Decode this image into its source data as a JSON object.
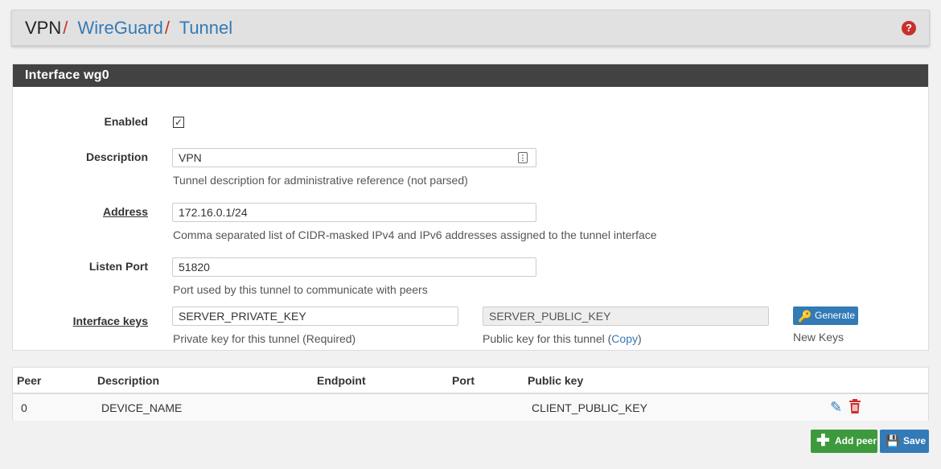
{
  "breadcrumb": {
    "root": "VPN",
    "level1": "WireGuard",
    "level2": "Tunnel",
    "separator": "/"
  },
  "help_icon": "question-circle-icon",
  "panel": {
    "title": "Interface wg0",
    "fields": {
      "enabled": {
        "label": "Enabled",
        "checked": true
      },
      "description": {
        "label": "Description",
        "value": "VPN",
        "hint": "Tunnel description for administrative reference (not parsed)"
      },
      "address": {
        "label": "Address",
        "value": "172.16.0.1/24",
        "hint": "Comma separated list of CIDR-masked IPv4 and IPv6 addresses assigned to the tunnel interface"
      },
      "listen_port": {
        "label": "Listen Port",
        "value": "51820",
        "hint": "Port used by this tunnel to communicate with peers"
      },
      "interface_keys": {
        "label": "Interface keys",
        "private_value": "SERVER_PRIVATE_KEY",
        "private_hint": "Private key for this tunnel (Required)",
        "public_value": "SERVER_PUBLIC_KEY",
        "public_hint_prefix": "Public key for this tunnel (",
        "public_hint_link": "Copy",
        "public_hint_suffix": ")",
        "generate_label": "Generate",
        "generate_hint": "New Keys"
      }
    }
  },
  "peers": {
    "columns": [
      "Peer",
      "Description",
      "Endpoint",
      "Port",
      "Public key"
    ],
    "rows": [
      {
        "peer": "0",
        "description": "DEVICE_NAME",
        "endpoint": "",
        "port": "",
        "public_key": "CLIENT_PUBLIC_KEY"
      }
    ]
  },
  "buttons": {
    "add_peer": "Add peer",
    "save": "Save"
  },
  "colors": {
    "link": "#337ab7",
    "separator": "#c9302c",
    "panel_header": "#424242",
    "add_button": "#3c9a3c",
    "save_button": "#337ab7",
    "delete_icon": "#c9302c"
  }
}
